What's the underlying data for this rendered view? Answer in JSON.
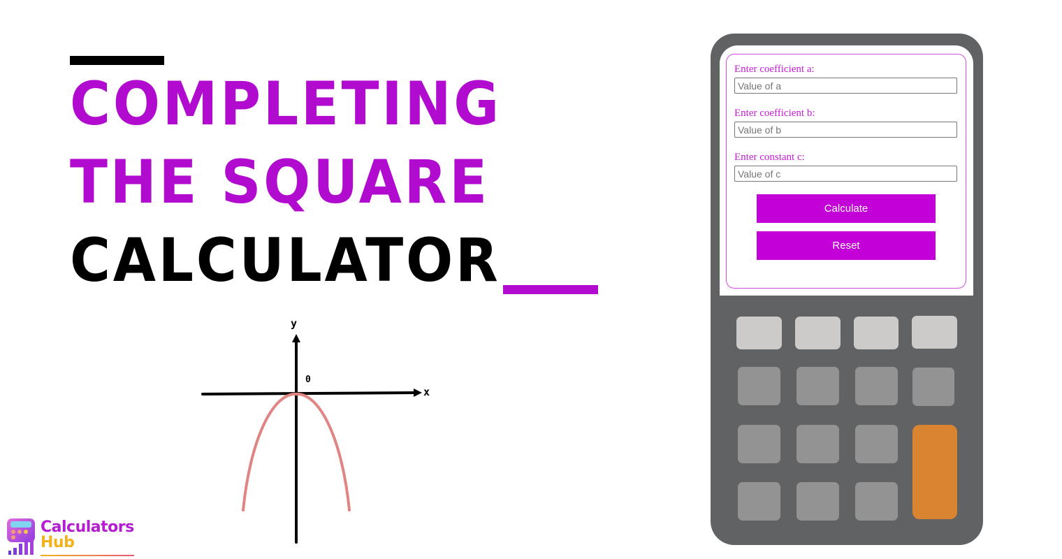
{
  "title": {
    "line1": "COMPLETING",
    "line2": "THE SQUARE",
    "line3": "CALCULATOR",
    "accent_color": "#b10bcf",
    "dark_color": "#000000"
  },
  "graph": {
    "y_label": "y",
    "x_label": "x",
    "origin_label": "0",
    "curve_color": "#e08484",
    "curve_description": "downward-opening parabola with vertex at origin"
  },
  "logo": {
    "line1": "Calculators",
    "line2": "Hub"
  },
  "calculator": {
    "fields": [
      {
        "label": "Enter coefficient a:",
        "placeholder": "Value of a",
        "value": ""
      },
      {
        "label": "Enter coefficient b:",
        "placeholder": "Value of b",
        "value": ""
      },
      {
        "label": "Enter constant c:",
        "placeholder": "Value of c",
        "value": ""
      }
    ],
    "calculate_label": "Calculate",
    "reset_label": "Reset",
    "button_color": "#c300d7",
    "body_color": "#616263",
    "key_colors": {
      "top_row": "#cccbc9",
      "number_keys": "#939393",
      "equals_key": "#d98431"
    }
  }
}
